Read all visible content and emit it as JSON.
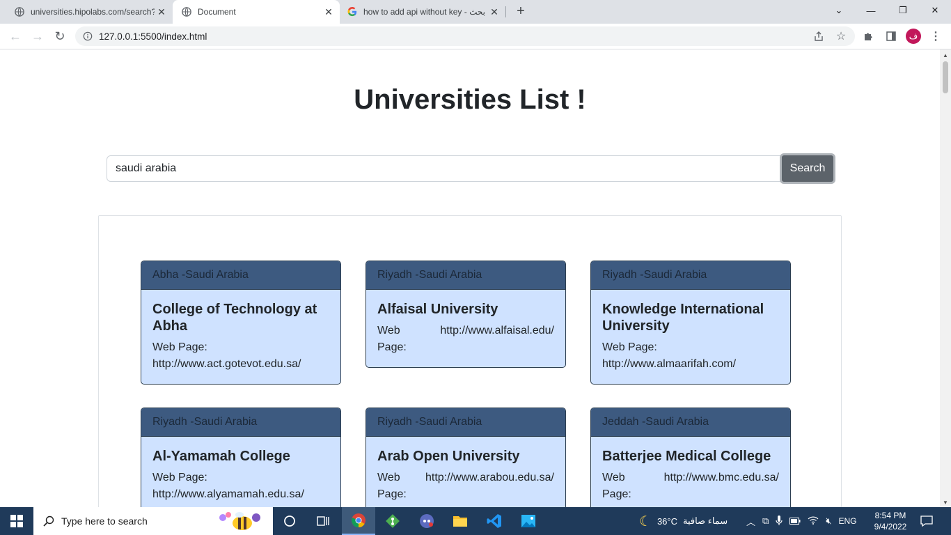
{
  "browser": {
    "tabs": [
      {
        "title": "universities.hipolabs.com/search?",
        "favicon": "globe-icon",
        "active": false
      },
      {
        "title": "Document",
        "favicon": "globe-icon",
        "active": true
      },
      {
        "title": "how to add api without key - بحث",
        "favicon": "google-icon",
        "active": false
      }
    ],
    "new_tab": "+",
    "url": "127.0.0.1:5500/index.html",
    "profile_initial": "ف"
  },
  "page": {
    "heading": "Universities List !",
    "search": {
      "value": "saudi arabia",
      "button_label": "Search"
    },
    "web_page_label": "Web Page:",
    "web_label": "Web",
    "page_label": "Page:",
    "cards": [
      {
        "location": "Abha -Saudi Arabia",
        "name": "College of Technology at Abha",
        "url": "http://www.act.gotevot.edu.sa/"
      },
      {
        "location": "Riyadh -Saudi Arabia",
        "name": "Alfaisal University",
        "url": "http://www.alfaisal.edu/"
      },
      {
        "location": "Riyadh -Saudi Arabia",
        "name": "Knowledge International University",
        "url": "http://www.almaarifah.com/"
      },
      {
        "location": "Riyadh -Saudi Arabia",
        "name": "Al-Yamamah College",
        "url": "http://www.alyamamah.edu.sa/"
      },
      {
        "location": "Riyadh -Saudi Arabia",
        "name": "Arab Open University",
        "url": "http://www.arabou.edu.sa/"
      },
      {
        "location": "Jeddah -Saudi Arabia",
        "name": "Batterjee Medical College",
        "url": "http://www.bmc.edu.sa/"
      }
    ]
  },
  "taskbar": {
    "search_placeholder": "Type here to search",
    "weather_temp": "36°C",
    "weather_text": "سماء صافية",
    "language": "ENG",
    "time": "8:54 PM",
    "date": "9/4/2022"
  },
  "colors": {
    "card_header": "#3d5a80",
    "card_body": "#cfe2ff",
    "search_button": "#5c636a",
    "taskbar": "#1f3a5a"
  }
}
